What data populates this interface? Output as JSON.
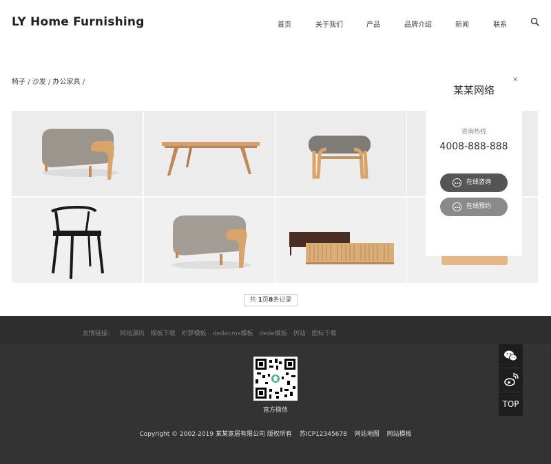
{
  "header": {
    "logo": "LY Home Furnishing",
    "nav": [
      {
        "label": "首页"
      },
      {
        "label": "关于我们"
      },
      {
        "label": "产品"
      },
      {
        "label": "品牌介绍"
      },
      {
        "label": "新闻"
      },
      {
        "label": "联系"
      }
    ],
    "search_icon": "search-icon"
  },
  "breadcrumb": {
    "items": [
      "椅子",
      "沙发",
      "办公家具"
    ],
    "separator": "/"
  },
  "products": [
    {
      "icon": "ottoman"
    },
    {
      "icon": "coffee-table"
    },
    {
      "icon": "bench-stool"
    },
    {
      "icon": "hidden"
    },
    {
      "icon": "chair"
    },
    {
      "icon": "ottoman"
    },
    {
      "icon": "tv-cabinet"
    },
    {
      "icon": "hidden"
    }
  ],
  "pagination": {
    "prefix": "共",
    "pages": "1",
    "mid": "页",
    "count": "8",
    "suffix": "条记录"
  },
  "footer": {
    "links_label": "友情链接：",
    "links": [
      "网站源码",
      "模板下载",
      "织梦模板",
      "dedecms模板",
      "dede模板",
      "仿站",
      "图标下载"
    ],
    "qr_label": "官方微信",
    "copyright": "Copyright © 2002-2019 某某家居有限公司 版权所有",
    "icp": "苏ICP12345678",
    "sitemap": "网站地图",
    "template": "网站模板"
  },
  "float_panel": {
    "title": "某某网络",
    "close": "×",
    "hotline_label": "咨询热线",
    "phone": "4008-888-888",
    "btn_consult": "在线咨询",
    "btn_reserve": "在线预约"
  },
  "side_tools": {
    "wechat_icon": "wechat-icon",
    "weibo_icon": "weibo-icon",
    "top_label": "TOP"
  },
  "colors": {
    "footer_top": "#2e2e2e",
    "footer_main": "#333333",
    "btn_dark": "#555555",
    "btn_light": "#8a8a8a"
  }
}
